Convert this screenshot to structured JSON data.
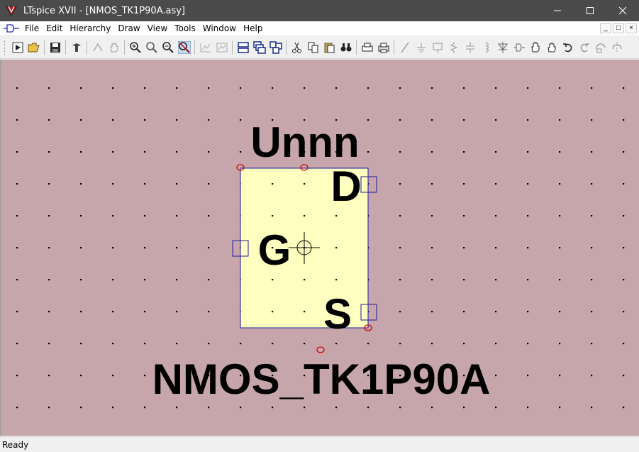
{
  "window": {
    "title": "LTspice XVII - [NMOS_TK1P90A.asy]",
    "app_icon": "ltspice-icon",
    "controls": [
      "minimize-icon",
      "maximize-icon",
      "close-icon"
    ]
  },
  "menu": {
    "items": [
      {
        "label": "File",
        "name": "menu-file"
      },
      {
        "label": "Edit",
        "name": "menu-edit"
      },
      {
        "label": "Hierarchy",
        "name": "menu-hierarchy"
      },
      {
        "label": "Draw",
        "name": "menu-draw"
      },
      {
        "label": "View",
        "name": "menu-view"
      },
      {
        "label": "Tools",
        "name": "menu-tools"
      },
      {
        "label": "Window",
        "name": "menu-window"
      },
      {
        "label": "Help",
        "name": "menu-help"
      }
    ],
    "mdi_controls": [
      "_",
      "□",
      "×"
    ]
  },
  "toolbar": {
    "icons": [
      "run-icon",
      "open-icon",
      "sep",
      "save-icon",
      "sep",
      "control-panel-icon",
      "sep",
      "halt-icon",
      "pan-icon",
      "sep",
      "zoom-in-icon",
      "zoom-rect-icon",
      "zoom-out-icon",
      "zoom-fit-icon",
      "sep",
      "autorange-icon",
      "plot-settings-icon",
      "sep",
      "tile-horizontal-icon",
      "cascade-icon",
      "tile-vertical-icon",
      "sep",
      "cut-icon",
      "copy-icon",
      "paste-icon",
      "find-icon",
      "sep",
      "print-preview-icon",
      "print-icon",
      "sep",
      "wire-icon",
      "ground-icon",
      "label-icon",
      "resistor-icon",
      "capacitor-icon",
      "inductor-icon",
      "diode-icon",
      "component-icon",
      "move-icon",
      "drag-icon",
      "undo-icon",
      "redo-icon",
      "rotate-icon",
      "mirror-icon"
    ]
  },
  "symbol": {
    "prefix_text": "Unnn",
    "name_text": "NMOS_TK1P90A",
    "pins": [
      {
        "label": "D"
      },
      {
        "label": "G"
      },
      {
        "label": "S"
      }
    ],
    "body_color": "#ffffc0",
    "outline_color": "#1a1aa0",
    "anchor_color": "#d40000"
  },
  "canvas": {
    "background": "#c6a6aa"
  },
  "status": {
    "text": "Ready"
  }
}
